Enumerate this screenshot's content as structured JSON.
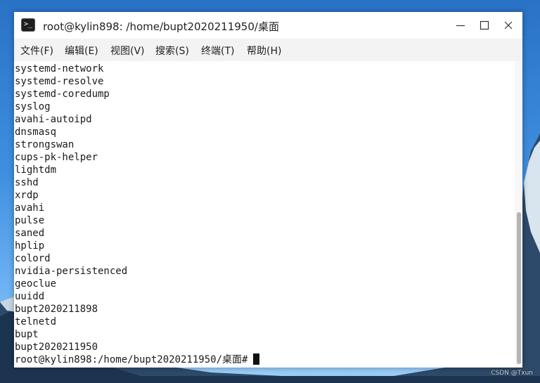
{
  "window": {
    "title": "root@kylin898: /home/bupt2020211950/桌面",
    "icon": "terminal-icon"
  },
  "menu": [
    {
      "label": "文件(F)"
    },
    {
      "label": "编辑(E)"
    },
    {
      "label": "视图(V)"
    },
    {
      "label": "搜索(S)"
    },
    {
      "label": "终端(T)"
    },
    {
      "label": "帮助(H)"
    }
  ],
  "terminal": {
    "lines": [
      "systemd-network",
      "systemd-resolve",
      "systemd-coredump",
      "syslog",
      "avahi-autoipd",
      "dnsmasq",
      "strongswan",
      "cups-pk-helper",
      "lightdm",
      "sshd",
      "xrdp",
      "avahi",
      "pulse",
      "saned",
      "hplip",
      "colord",
      "nvidia-persistenced",
      "geoclue",
      "uuidd",
      "bupt2020211898",
      "telnetd",
      "bupt",
      "bupt2020211950"
    ],
    "prompt": "root@kylin898:/home/bupt2020211950/桌面#"
  },
  "watermark": "CSDN @Txun",
  "colors": {
    "menu_bg": "#f3f3f3",
    "terminal_bg": "#ffffff",
    "desktop_sky": "#3f8fe0"
  }
}
